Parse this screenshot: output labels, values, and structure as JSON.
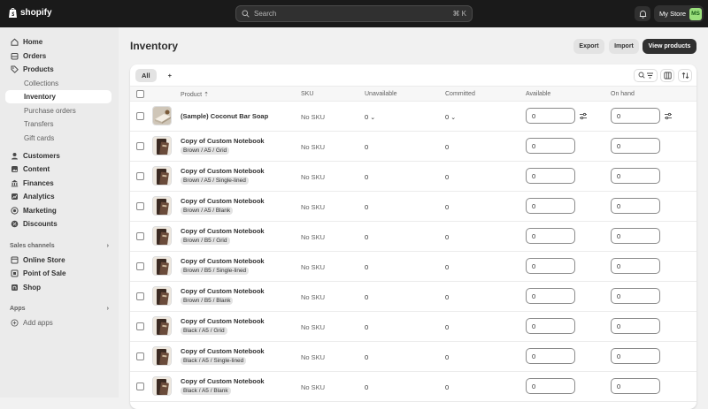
{
  "topbar": {
    "logo_text": "shopify",
    "search_placeholder": "Search",
    "search_shortcut": "⌘ K",
    "store_name": "My Store",
    "avatar_initials": "MS"
  },
  "sidebar": {
    "items": [
      {
        "label": "Home",
        "icon": "home-icon"
      },
      {
        "label": "Orders",
        "icon": "orders-icon"
      },
      {
        "label": "Products",
        "icon": "tag-icon"
      },
      {
        "label": "Collections"
      },
      {
        "label": "Inventory"
      },
      {
        "label": "Purchase orders"
      },
      {
        "label": "Transfers"
      },
      {
        "label": "Gift cards"
      },
      {
        "label": "Customers",
        "icon": "person-icon"
      },
      {
        "label": "Content",
        "icon": "content-icon"
      },
      {
        "label": "Finances",
        "icon": "bank-icon"
      },
      {
        "label": "Analytics",
        "icon": "chart-icon"
      },
      {
        "label": "Marketing",
        "icon": "target-icon"
      },
      {
        "label": "Discounts",
        "icon": "discount-icon"
      }
    ],
    "sales_channels_label": "Sales channels",
    "channels": [
      {
        "label": "Online Store"
      },
      {
        "label": "Point of Sale"
      },
      {
        "label": "Shop"
      }
    ],
    "apps_label": "Apps",
    "add_apps_label": "Add apps"
  },
  "page": {
    "title": "Inventory",
    "export_label": "Export",
    "import_label": "Import",
    "view_products_label": "View products"
  },
  "tabs": {
    "all_label": "All",
    "add_label": "+"
  },
  "table": {
    "headers": {
      "product": "Product",
      "sku": "SKU",
      "unavailable": "Unavailable",
      "committed": "Committed",
      "available": "Available",
      "on_hand": "On hand"
    },
    "rows": [
      {
        "name": "(Sample) Coconut Bar Soap",
        "variant": "",
        "sku": "No SKU",
        "unavailable": "0",
        "committed": "0",
        "available": "0",
        "on_hand": "0"
      },
      {
        "name": "Copy of Custom Notebook",
        "variant": "Brown / A5 / Grid",
        "sku": "No SKU",
        "unavailable": "0",
        "committed": "0",
        "available": "0",
        "on_hand": "0"
      },
      {
        "name": "Copy of Custom Notebook",
        "variant": "Brown / A5 / Single-lined",
        "sku": "No SKU",
        "unavailable": "0",
        "committed": "0",
        "available": "0",
        "on_hand": "0"
      },
      {
        "name": "Copy of Custom Notebook",
        "variant": "Brown / A5 / Blank",
        "sku": "No SKU",
        "unavailable": "0",
        "committed": "0",
        "available": "0",
        "on_hand": "0"
      },
      {
        "name": "Copy of Custom Notebook",
        "variant": "Brown / B5 / Grid",
        "sku": "No SKU",
        "unavailable": "0",
        "committed": "0",
        "available": "0",
        "on_hand": "0"
      },
      {
        "name": "Copy of Custom Notebook",
        "variant": "Brown / B5 / Single-lined",
        "sku": "No SKU",
        "unavailable": "0",
        "committed": "0",
        "available": "0",
        "on_hand": "0"
      },
      {
        "name": "Copy of Custom Notebook",
        "variant": "Brown / B5 / Blank",
        "sku": "No SKU",
        "unavailable": "0",
        "committed": "0",
        "available": "0",
        "on_hand": "0"
      },
      {
        "name": "Copy of Custom Notebook",
        "variant": "Black / A5 / Grid",
        "sku": "No SKU",
        "unavailable": "0",
        "committed": "0",
        "available": "0",
        "on_hand": "0"
      },
      {
        "name": "Copy of Custom Notebook",
        "variant": "Black / A5 / Single-lined",
        "sku": "No SKU",
        "unavailable": "0",
        "committed": "0",
        "available": "0",
        "on_hand": "0"
      },
      {
        "name": "Copy of Custom Notebook",
        "variant": "Black / A5 / Blank",
        "sku": "No SKU",
        "unavailable": "0",
        "committed": "0",
        "available": "0",
        "on_hand": "0"
      }
    ]
  },
  "colors": {
    "topbar": "#1a1a1a",
    "sidebar": "#ebebeb",
    "primary_button": "#303030",
    "avatar": "#9ae07c"
  }
}
